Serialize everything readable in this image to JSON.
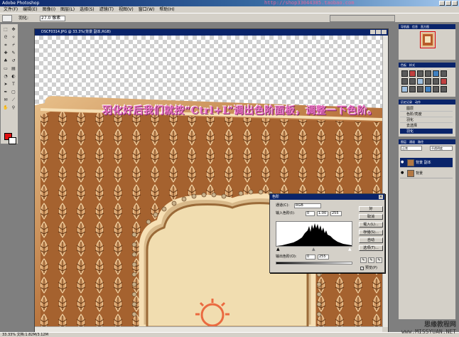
{
  "app": {
    "title": "Adobe Photoshop",
    "watermark_url": "http://shop33044385.taobao.com"
  },
  "menu": [
    "文件(F)",
    "编辑(E)",
    "图像(I)",
    "图层(L)",
    "选择(S)",
    "滤镜(T)",
    "视图(V)",
    "窗口(W)",
    "帮助(H)"
  ],
  "options": {
    "label": "羽化:",
    "value": "27.0 像素"
  },
  "document": {
    "title": "DSCF0314.JPG @ 33.3%(背景 副本,RGB)"
  },
  "caption": "羽化好后我们就按“Ctrl+L”调出色阶面板，调整一下色阶。",
  "levels": {
    "title": "色阶",
    "channel_label": "通道(C):",
    "channel_value": "RGB",
    "input_label": "输入色阶(I):",
    "input_values": [
      "0",
      "1.00",
      "255"
    ],
    "output_label": "输出色阶(O):",
    "output_values": [
      "0",
      "255"
    ],
    "buttons": [
      "好",
      "取消",
      "载入(L)...",
      "存储(S)...",
      "自动",
      "选项(T)..."
    ],
    "eyedroppers": [
      "✎",
      "✎",
      "✎"
    ],
    "preview_label": "预览(P)",
    "preview_checked": true
  },
  "panels": {
    "navigator_tabs": [
      "导航器",
      "信息",
      "直方图"
    ],
    "adjust_tabs": [
      "色板",
      "样式"
    ],
    "history_tabs": [
      "历史记录",
      "动作"
    ],
    "history_items": [
      "图层",
      "色阶/亮度",
      "羽化",
      "去选择",
      "新建图层",
      "羽化"
    ],
    "layers_tabs": [
      "图层",
      "通道",
      "路径"
    ],
    "layer_mode": "正常",
    "layer_opacity": "不透明度",
    "layers": [
      {
        "name": "背景 副本",
        "selected": true
      },
      {
        "name": "背景",
        "selected": false
      }
    ]
  },
  "status": {
    "text": "33.33%   文档:1.82M/3.12M"
  },
  "footer": {
    "site": "思缘教程网",
    "url": "www.MISSYUAN.NET"
  },
  "colors": {
    "foreground": "#e01010",
    "background": "#ffffff",
    "caption": "#ea70c2"
  }
}
